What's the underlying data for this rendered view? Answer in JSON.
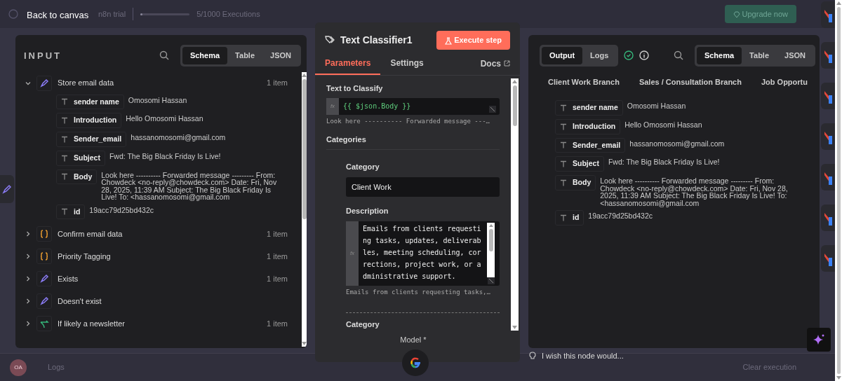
{
  "canvas": {
    "trial_label": "n8n trial",
    "executions": "5/1000 Executions",
    "executions_usage": {
      "level": 0.005
    },
    "upgrade_button": "Upgrade now",
    "avatar": "OA",
    "logs_label": "Logs",
    "clear_button": "Clear execution"
  },
  "back_link": "Back to canvas",
  "input_panel": {
    "title": "INPUT",
    "view_tabs": [
      {
        "label": "Schema",
        "selected": true
      },
      {
        "label": "Table",
        "selected": false
      },
      {
        "label": "JSON",
        "selected": false
      }
    ],
    "nodes": [
      {
        "name": "Store email data",
        "kind": "edit",
        "count": "1 item",
        "expanded": true,
        "fields": [
          {
            "key": "sender name",
            "value": "Omosomi Hassan"
          },
          {
            "key": "Introduction",
            "value": "Hello Omosomi Hassan"
          },
          {
            "key": "Sender_email",
            "value": "hassanomosomi@gmail.com"
          },
          {
            "key": "Subject",
            "value": "Fwd: The Big Black Friday Is Live!"
          },
          {
            "key": "Body",
            "value": "Look here ---------- Forwarded message --------- From: Chowdeck <no-reply@chowdeck.com> Date: Fri, Nov 28, 2025, 11:39 AM Subject: The Big Black Friday Is Live! To: <hassanomosomi@gmail.com"
          },
          {
            "key": "id",
            "value": "19acc79d25bd432c"
          }
        ]
      },
      {
        "name": "Confirm email data",
        "kind": "code",
        "count": "1 item",
        "expanded": false
      },
      {
        "name": "Priority Tagging",
        "kind": "code",
        "count": "1 item",
        "expanded": false
      },
      {
        "name": "Exists",
        "kind": "edit",
        "count": "1 item",
        "expanded": false
      },
      {
        "name": "Doesn't exist",
        "kind": "edit",
        "expanded": false
      },
      {
        "name": "If likely a newsletter",
        "kind": "branch",
        "count": "1 item",
        "expanded": false
      }
    ]
  },
  "node": {
    "title": "Text Classifier1",
    "execute_button": "Execute step",
    "tabs": [
      {
        "label": "Parameters",
        "selected": true
      },
      {
        "label": "Settings",
        "selected": false
      }
    ],
    "docs_link": "Docs",
    "text_label": "Text to Classify",
    "text_fx": "fx",
    "text_expression": "{{ $json.Body }}",
    "text_preview": "Look here ---------- Forwarded message ---…",
    "categories_label": "Categories",
    "categories": [
      {
        "category_label": "Category",
        "category_value": "Client Work",
        "description_label": "Description",
        "description_fx": "fx",
        "description": "Emails from clients requesting tasks, updates, deliverables, meeting scheduling, corrections, project work, or administrative support.",
        "description_preview": "Emails from clients requesting tasks,…"
      }
    ],
    "next_category_label": "Category",
    "model_label": "Model *"
  },
  "output_panel": {
    "mode_tabs": [
      {
        "label": "Output",
        "selected": true
      },
      {
        "label": "Logs",
        "selected": false
      }
    ],
    "view_tabs": [
      {
        "label": "Schema",
        "selected": true
      },
      {
        "label": "Table",
        "selected": false
      },
      {
        "label": "JSON",
        "selected": false
      }
    ],
    "branches": [
      "Client Work Branch",
      "Sales / Consultation Branch",
      "Job Opportu"
    ],
    "fields": [
      {
        "key": "sender name",
        "value": "Omosomi Hassan"
      },
      {
        "key": "Introduction",
        "value": "Hello Omosomi Hassan"
      },
      {
        "key": "Sender_email",
        "value": "hassanomosomi@gmail.com"
      },
      {
        "key": "Subject",
        "value": "Fwd: The Big Black Friday Is Live!"
      },
      {
        "key": "Body",
        "value": "Look here ---------- Forwarded message --------- From: Chowdeck <no-reply@chowdeck.com> Date: Fri, Nov 28, 2025, 11:39 AM Subject: The Big Black Friday Is Live! To: <hassanomosomi@gmail.com"
      },
      {
        "key": "id",
        "value": "19acc79d25bd432c"
      }
    ]
  },
  "ai_prompt": "I wish this node would..."
}
